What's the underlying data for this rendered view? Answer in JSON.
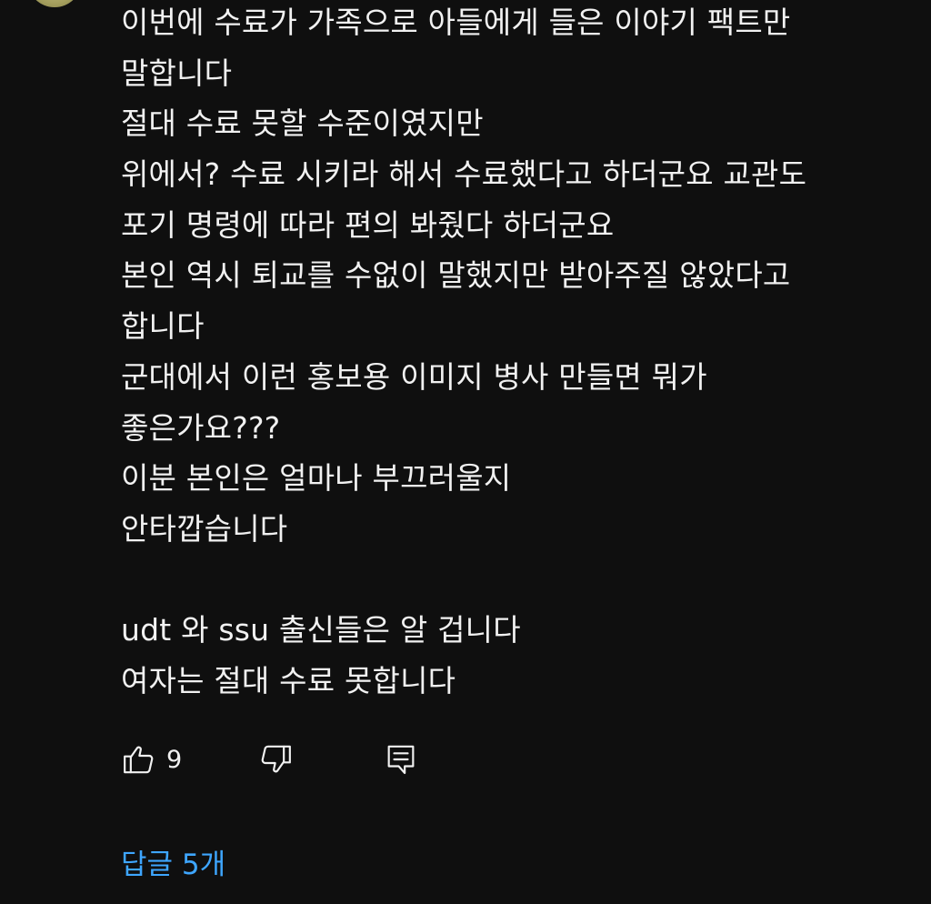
{
  "comment": {
    "lines": [
      "이번에 수료가 가족으로 아들에게 들은 이야기 팩트만",
      "말합니다",
      "절대 수료 못할 수준이였지만",
      "위에서? 수료 시키라 해서 수료했다고 하더군요 교관도",
      "포기 명령에 따라 편의 봐줬다 하더군요",
      "본인 역시 퇴교를 수없이 말했지만 받아주질 않았다고",
      "합니다",
      "군대에서 이런 홍보용 이미지 병사 만들면 뭐가",
      "좋은가요???",
      "이분 본인은 얼마나 부끄러울지",
      "안타깝습니다",
      "",
      "udt 와 ssu 출신들은 알 겁니다",
      "여자는 절대 수료 못합니다"
    ]
  },
  "actions": {
    "like_icon": "thumbs-up-icon",
    "like_count": "9",
    "dislike_icon": "thumbs-down-icon",
    "reply_icon": "reply-comment-icon"
  },
  "replies": {
    "label": "답글 5개"
  },
  "colors": {
    "background": "#0f0f0f",
    "text": "#f1f1f1",
    "link": "#3ea6ff"
  }
}
